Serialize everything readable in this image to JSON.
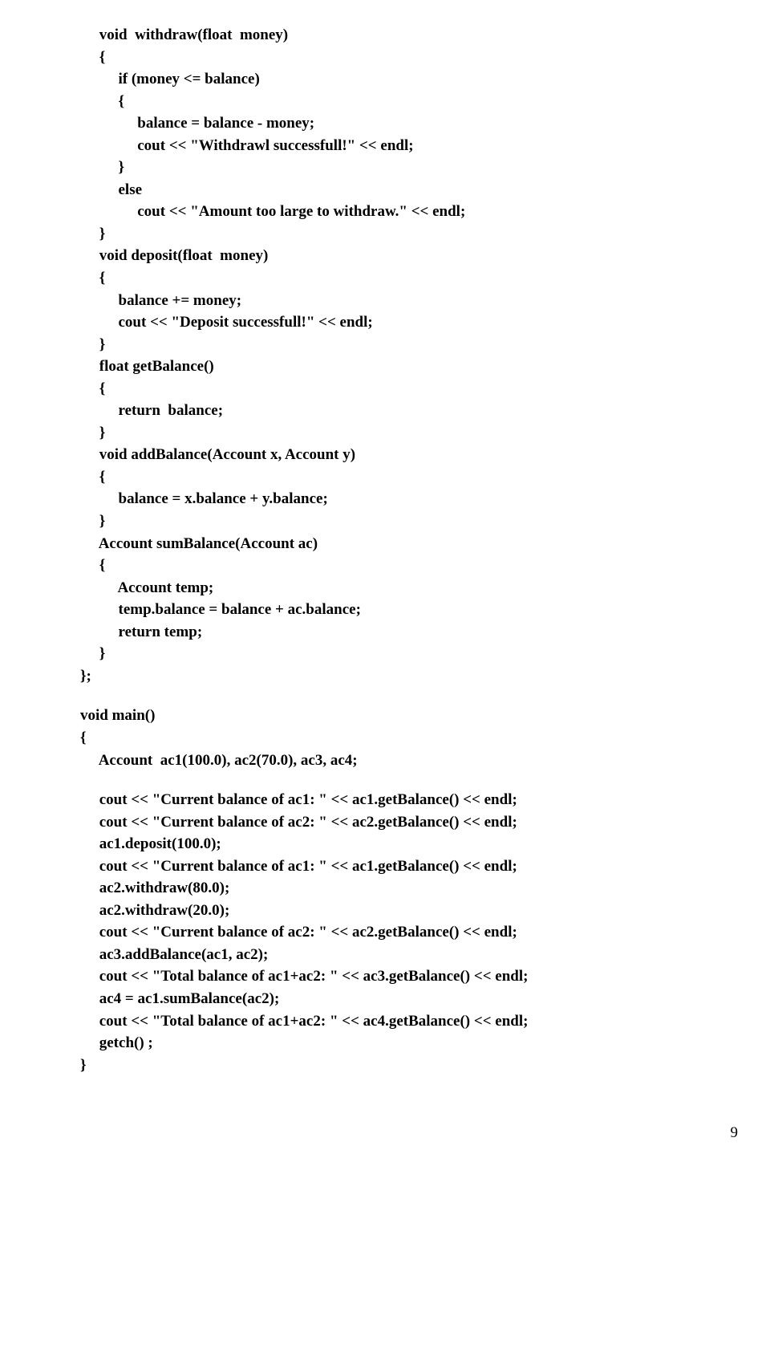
{
  "code": {
    "block1": "     void  withdraw(float  money)\n     {\n          if (money <= balance)\n          {\n               balance = balance - money;\n               cout << \"Withdrawl successfull!\" << endl;\n          }\n          else\n               cout << \"Amount too large to withdraw.\" << endl;\n     }\n     void deposit(float  money)\n     {\n          balance += money;\n          cout << \"Deposit successfull!\" << endl;\n     }\n     float getBalance()\n     {\n          return  balance;\n     }\n     void addBalance(Account x, Account y)\n     {\n          balance = x.balance + y.balance;\n     }\n     Account sumBalance(Account ac)\n     {\n          Account temp;\n          temp.balance = balance + ac.balance;\n          return temp;\n     }\n};",
    "block2": "void main()\n{\n     Account  ac1(100.0), ac2(70.0), ac3, ac4;",
    "block3": "     cout << \"Current balance of ac1: \" << ac1.getBalance() << endl;\n     cout << \"Current balance of ac2: \" << ac2.getBalance() << endl;\n     ac1.deposit(100.0);\n     cout << \"Current balance of ac1: \" << ac1.getBalance() << endl;\n     ac2.withdraw(80.0);\n     ac2.withdraw(20.0);\n     cout << \"Current balance of ac2: \" << ac2.getBalance() << endl;\n     ac3.addBalance(ac1, ac2);\n     cout << \"Total balance of ac1+ac2: \" << ac3.getBalance() << endl;\n     ac4 = ac1.sumBalance(ac2);\n     cout << \"Total balance of ac1+ac2: \" << ac4.getBalance() << endl;\n     getch() ;\n}"
  },
  "pageNumber": "9"
}
